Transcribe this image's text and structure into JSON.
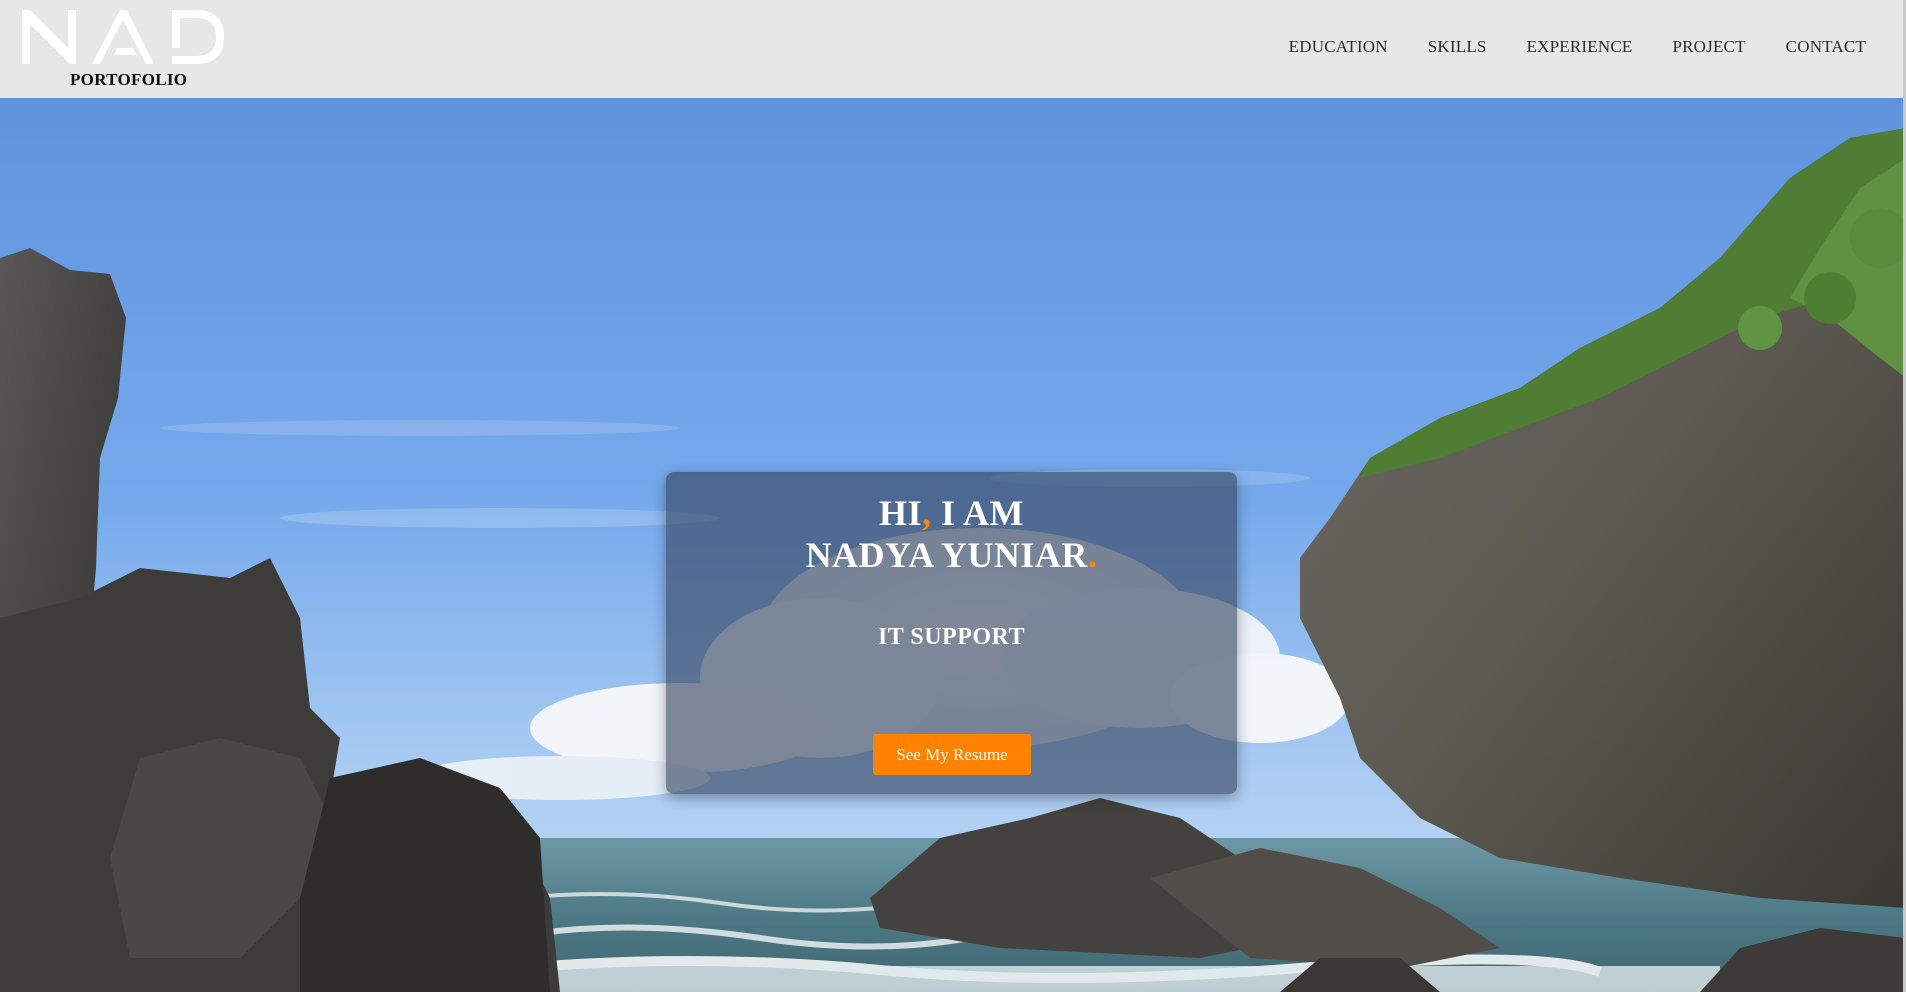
{
  "brand": {
    "logo_text": "NAD",
    "subtitle": "PORTOFOLIO"
  },
  "nav": {
    "items": [
      {
        "label": "EDUCATION"
      },
      {
        "label": "SKILLS"
      },
      {
        "label": "EXPERIENCE"
      },
      {
        "label": "PROJECT"
      },
      {
        "label": "CONTACT"
      }
    ]
  },
  "hero": {
    "greeting_prefix": "HI",
    "greeting_comma": ",",
    "greeting_suffix": " I AM",
    "name": "NADYA YUNIAR",
    "name_dot": ".",
    "role": "IT SUPPORT",
    "cta_label": "See My Resume"
  },
  "colors": {
    "accent": "#ff8a00",
    "header_bg": "#e7e7e7",
    "card_bg": "#34425c",
    "button_bg": "#ff8200"
  }
}
